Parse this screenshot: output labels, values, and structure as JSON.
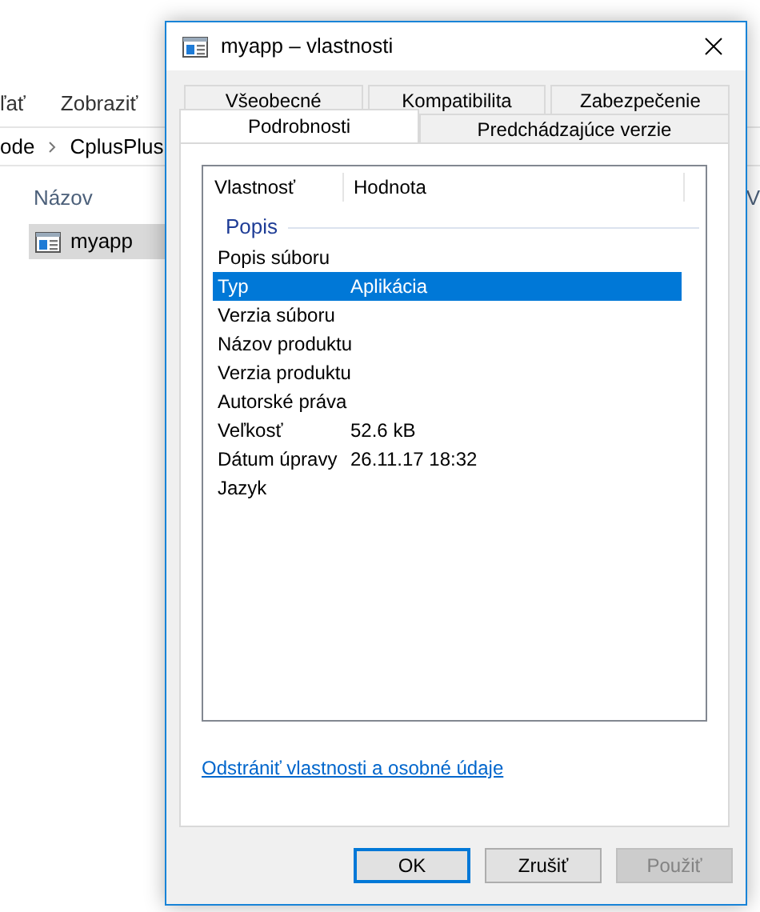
{
  "background_window": {
    "ribbon_tabs": [
      "ľať",
      "Zobraziť"
    ],
    "breadcrumb": [
      "ode",
      "CplusPlus"
    ],
    "right_edge_texts": [
      "V"
    ],
    "column_header": "Názov",
    "files": [
      {
        "name": "myapp",
        "selected": true
      }
    ]
  },
  "dialog": {
    "title": "myapp – vlastnosti",
    "tab_rows": [
      [
        {
          "label": "Všeobecné",
          "selected": false
        },
        {
          "label": "Kompatibilita",
          "selected": false
        },
        {
          "label": "Zabezpečenie",
          "selected": false
        }
      ],
      [
        {
          "label": "Podrobnosti",
          "selected": true
        },
        {
          "label": "Predchádzajúce verzie",
          "selected": false
        }
      ]
    ],
    "columns": [
      "Vlastnosť",
      "Hodnota"
    ],
    "group": "Popis",
    "properties": [
      {
        "name": "Popis súboru",
        "selected": false
      },
      {
        "name": "Typ",
        "value": "Aplikácia",
        "selected": true
      },
      {
        "name": "Verzia súboru",
        "selected": false
      },
      {
        "name": "Názov produktu",
        "selected": false
      },
      {
        "name": "Verzia produktu",
        "selected": false
      },
      {
        "name": "Autorské práva",
        "selected": false
      },
      {
        "name": "Veľkosť",
        "value": "52.6 kB",
        "selected": false
      },
      {
        "name": "Dátum úpravy",
        "value": "26.11.17 18:32",
        "selected": false
      },
      {
        "name": "Jazyk",
        "selected": false
      }
    ],
    "link": "Odstrániť vlastnosti a osobné údaje",
    "buttons": [
      {
        "label": "OK",
        "kind": "default",
        "disabled": false
      },
      {
        "label": "Zrušiť",
        "kind": "normal",
        "disabled": false
      },
      {
        "label": "Použiť",
        "kind": "normal",
        "disabled": true
      }
    ]
  }
}
